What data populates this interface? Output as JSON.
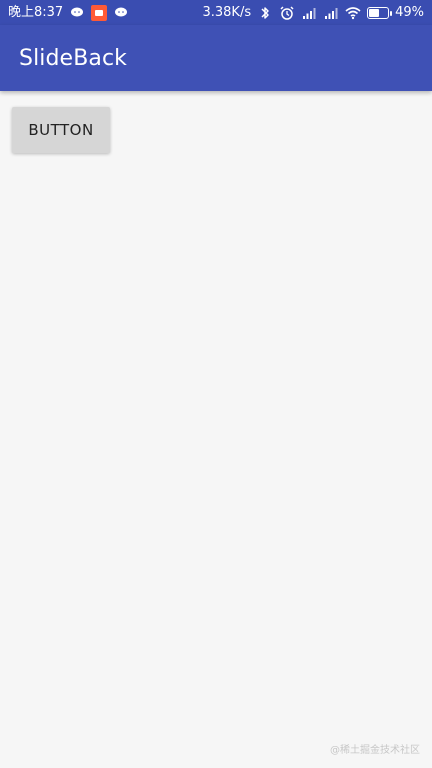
{
  "status_bar": {
    "time": "晚上8:37",
    "network_speed": "3.38K/s",
    "battery_percent": "49%",
    "battery_level": 0.49
  },
  "app_bar": {
    "title": "SlideBack"
  },
  "content": {
    "button_label": "BUTTON"
  },
  "watermark": "@稀土掘金技术社区",
  "colors": {
    "status_bar": "#3a4db1",
    "app_bar": "#3f51b5",
    "background": "#f6f6f6",
    "button": "#d6d6d6"
  },
  "icons": {
    "left": [
      "chat-bubble-icon",
      "app-notification-icon",
      "chat-bubble-icon"
    ],
    "right": [
      "bluetooth-icon",
      "alarm-icon",
      "signal-icon",
      "signal-icon",
      "wifi-icon",
      "battery-icon"
    ]
  }
}
